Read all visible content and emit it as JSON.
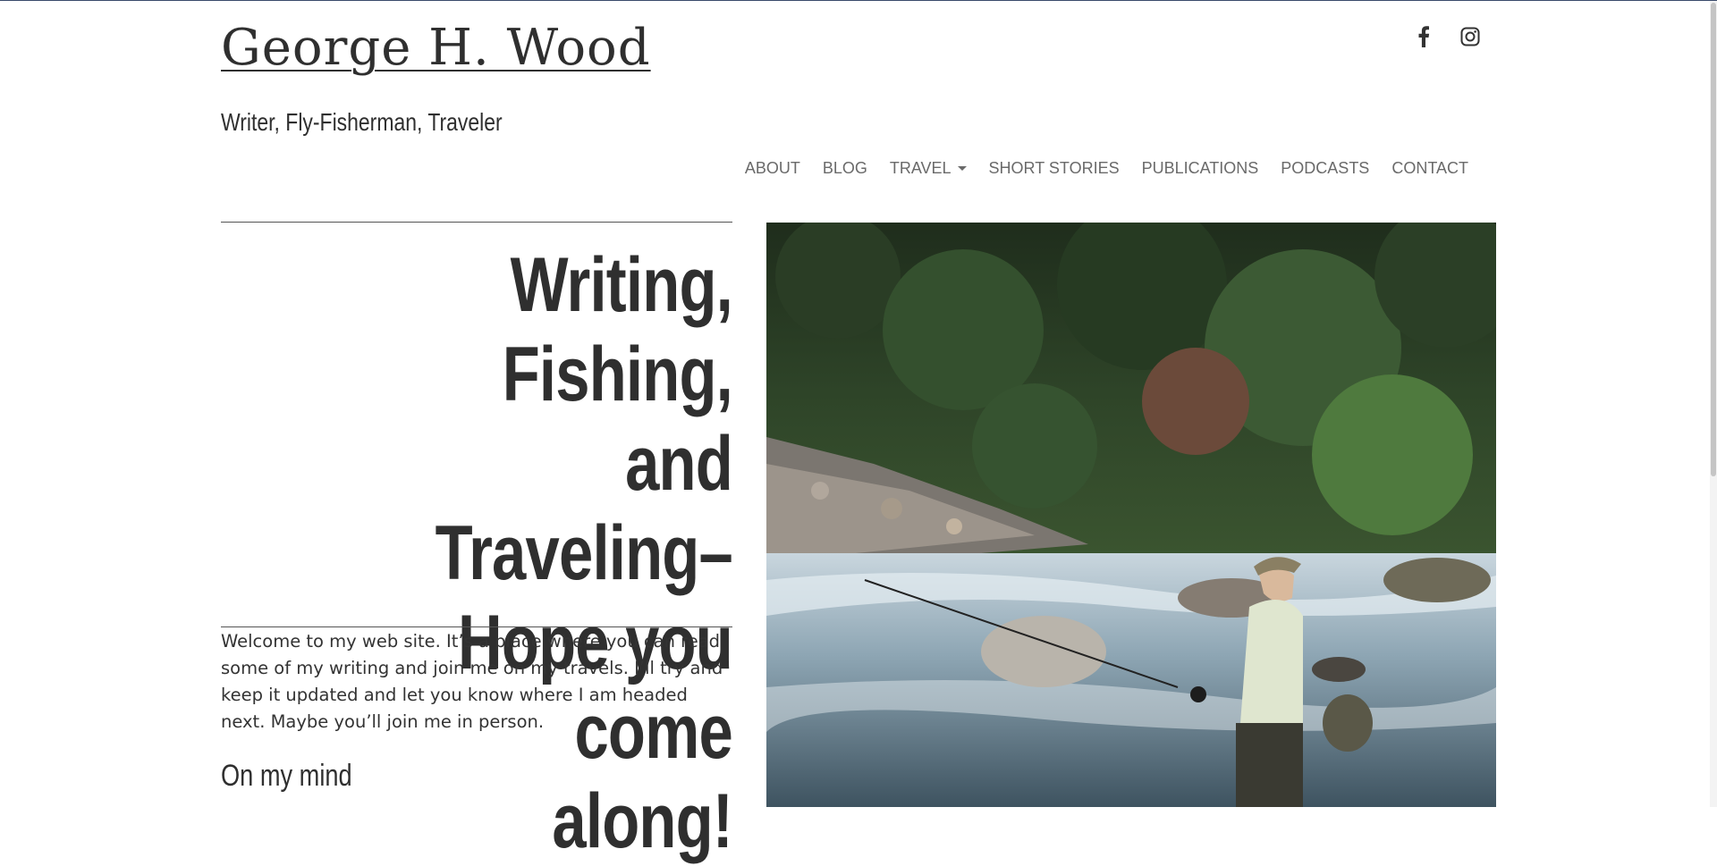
{
  "site": {
    "title": "George H. Wood",
    "tagline": "Writer, Fly-Fisherman, Traveler"
  },
  "social": [
    {
      "icon": "facebook-icon",
      "label": "Facebook"
    },
    {
      "icon": "instagram-icon",
      "label": "Instagram"
    }
  ],
  "nav": {
    "items": [
      {
        "label": "ABOUT"
      },
      {
        "label": "BLOG"
      },
      {
        "label": "TRAVEL",
        "has_dropdown": true
      },
      {
        "label": "SHORT STORIES"
      },
      {
        "label": "PUBLICATIONS"
      },
      {
        "label": "PODCASTS"
      },
      {
        "label": "CONTACT"
      }
    ]
  },
  "main": {
    "headline_lines": [
      "Writing, Fishing,",
      "and Traveling–",
      "Hope you come",
      "along!"
    ],
    "intro": "Welcome to my web site.  It’s a place where you can read some of my writing and join me on my travels.  I’ll try and keep it updated and let you know where I am headed next.  Maybe you’ll join me in person.",
    "section_heading": "On my mind"
  },
  "hero_image": {
    "subject": "fly-fisherman-in-river-photo"
  },
  "colors": {
    "text": "#2f2f2f",
    "nav": "#6a6a6a",
    "top_border": "#3a4a6b"
  }
}
